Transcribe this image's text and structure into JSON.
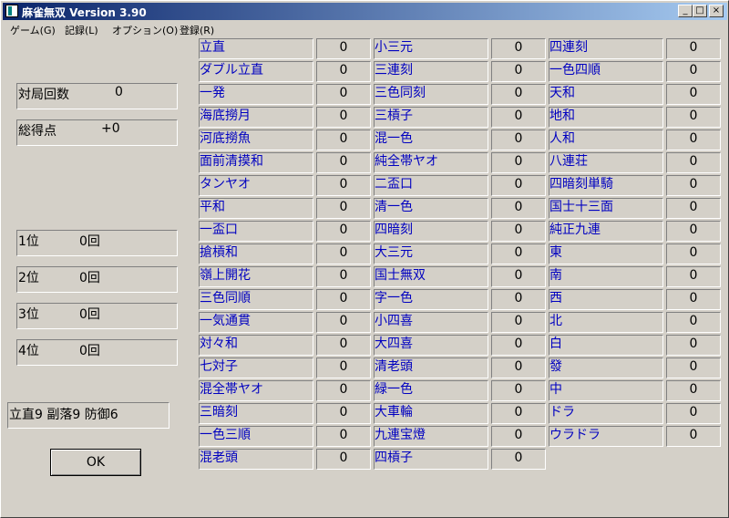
{
  "window": {
    "title": "麻雀無双 Version 3.90",
    "minimize": "_",
    "maximize": "□",
    "close": "×"
  },
  "menu": [
    "ゲーム(G)",
    "記録(L)",
    "オプション(O)",
    "登録(R)"
  ],
  "stats": {
    "games_label": "対局回数",
    "games_value": "0",
    "points_label": "総得点",
    "points_value": "+0",
    "places": [
      {
        "label": "1位",
        "value": "0回"
      },
      {
        "label": "2位",
        "value": "0回"
      },
      {
        "label": "3位",
        "value": "0回"
      },
      {
        "label": "4位",
        "value": "0回"
      }
    ],
    "style_text": "立直9 副落9 防御6"
  },
  "ok_label": "OK",
  "yaku_columns": [
    [
      {
        "name": "立直",
        "count": "0"
      },
      {
        "name": "ダブル立直",
        "count": "0"
      },
      {
        "name": "一発",
        "count": "0"
      },
      {
        "name": "海底撈月",
        "count": "0"
      },
      {
        "name": "河底撈魚",
        "count": "0"
      },
      {
        "name": "面前清摸和",
        "count": "0"
      },
      {
        "name": "タンヤオ",
        "count": "0"
      },
      {
        "name": "平和",
        "count": "0"
      },
      {
        "name": "一盃口",
        "count": "0"
      },
      {
        "name": "搶槓和",
        "count": "0"
      },
      {
        "name": "嶺上開花",
        "count": "0"
      },
      {
        "name": "三色同順",
        "count": "0"
      },
      {
        "name": "一気通貫",
        "count": "0"
      },
      {
        "name": "対々和",
        "count": "0"
      },
      {
        "name": "七対子",
        "count": "0"
      },
      {
        "name": "混全帯ヤオ",
        "count": "0"
      },
      {
        "name": "三暗刻",
        "count": "0"
      },
      {
        "name": "一色三順",
        "count": "0"
      },
      {
        "name": "混老頭",
        "count": "0"
      }
    ],
    [
      {
        "name": "小三元",
        "count": "0"
      },
      {
        "name": "三連刻",
        "count": "0"
      },
      {
        "name": "三色同刻",
        "count": "0"
      },
      {
        "name": "三槓子",
        "count": "0"
      },
      {
        "name": "混一色",
        "count": "0"
      },
      {
        "name": "純全帯ヤオ",
        "count": "0"
      },
      {
        "name": "二盃口",
        "count": "0"
      },
      {
        "name": "清一色",
        "count": "0"
      },
      {
        "name": "四暗刻",
        "count": "0"
      },
      {
        "name": "大三元",
        "count": "0"
      },
      {
        "name": "国士無双",
        "count": "0"
      },
      {
        "name": "字一色",
        "count": "0"
      },
      {
        "name": "小四喜",
        "count": "0"
      },
      {
        "name": "大四喜",
        "count": "0"
      },
      {
        "name": "清老頭",
        "count": "0"
      },
      {
        "name": "緑一色",
        "count": "0"
      },
      {
        "name": "大車輪",
        "count": "0"
      },
      {
        "name": "九連宝燈",
        "count": "0"
      },
      {
        "name": "四槓子",
        "count": "0"
      }
    ],
    [
      {
        "name": "四連刻",
        "count": "0"
      },
      {
        "name": "一色四順",
        "count": "0"
      },
      {
        "name": "天和",
        "count": "0"
      },
      {
        "name": "地和",
        "count": "0"
      },
      {
        "name": "人和",
        "count": "0"
      },
      {
        "name": "八連荘",
        "count": "0"
      },
      {
        "name": "四暗刻単騎",
        "count": "0"
      },
      {
        "name": "国士十三面",
        "count": "0"
      },
      {
        "name": "純正九連",
        "count": "0"
      },
      {
        "name": "東",
        "count": "0"
      },
      {
        "name": "南",
        "count": "0"
      },
      {
        "name": "西",
        "count": "0"
      },
      {
        "name": "北",
        "count": "0"
      },
      {
        "name": "白",
        "count": "0"
      },
      {
        "name": "發",
        "count": "0"
      },
      {
        "name": "中",
        "count": "0"
      },
      {
        "name": "ドラ",
        "count": "0"
      },
      {
        "name": "ウラドラ",
        "count": "0"
      }
    ]
  ]
}
